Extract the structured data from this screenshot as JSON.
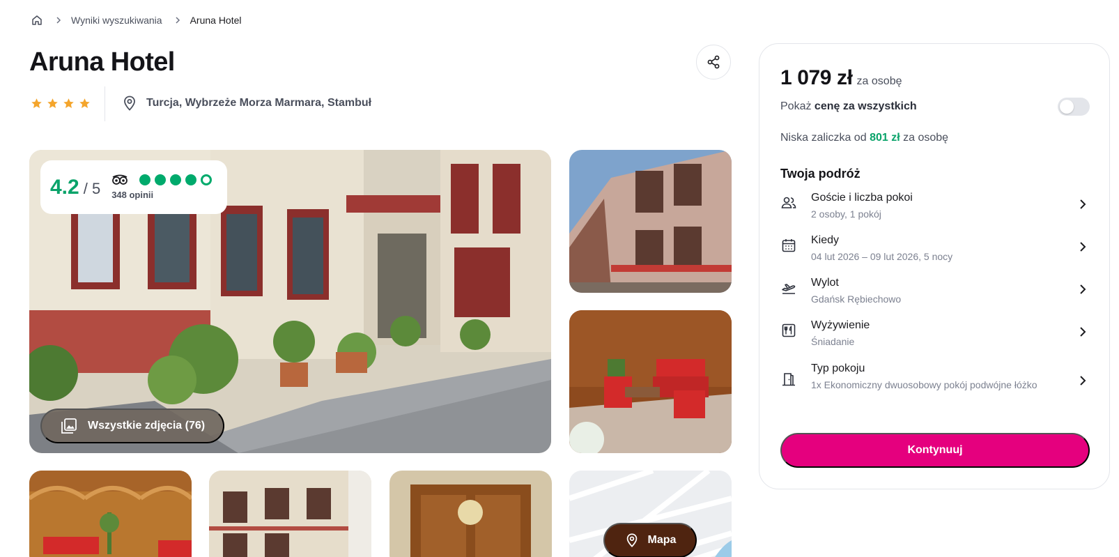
{
  "breadcrumb": {
    "home_icon": "home-icon",
    "items": [
      "Wyniki wyszukiwania",
      "Aruna Hotel"
    ]
  },
  "hotel": {
    "name": "Aruna Hotel",
    "stars": 4,
    "location": "Turcja, Wybrzeże Morza Marmara, Stambuł"
  },
  "rating": {
    "score": "4.2",
    "of": "/ 5",
    "bubbles": 4,
    "opinions": "348 opinii"
  },
  "gallery": {
    "all_photos_label": "Wszystkie zdjęcia (76)",
    "map_label": "Mapa"
  },
  "booking": {
    "price": "1 079 zł",
    "price_unit": "za osobę",
    "toggle_prefix": "Pokaż",
    "toggle_bold": "cenę za wszystkich",
    "toggle_on": false,
    "deposit_prefix": "Niska zaliczka od",
    "deposit_amount": "801 zł",
    "deposit_suffix": "za osobę",
    "trip_title": "Twoja podróż",
    "rows": [
      {
        "icon": "guests-icon",
        "label": "Goście i liczba pokoi",
        "value": "2 osoby, 1 pokój"
      },
      {
        "icon": "calendar-icon",
        "label": "Kiedy",
        "value": "04 lut 2026 – 09 lut 2026, 5 nocy"
      },
      {
        "icon": "plane-icon",
        "label": "Wylot",
        "value": "Gdańsk Rębiechowo"
      },
      {
        "icon": "meal-icon",
        "label": "Wyżywienie",
        "value": "Śniadanie"
      },
      {
        "icon": "room-icon",
        "label": "Typ pokoju",
        "value": "1x Ekonomiczny dwuosobowy pokój podwójne łóżko"
      }
    ],
    "cta": "Kontynuuj"
  },
  "colors": {
    "accent": "#e5007e",
    "green": "#0aa36a",
    "map_button": "#4f2410"
  }
}
